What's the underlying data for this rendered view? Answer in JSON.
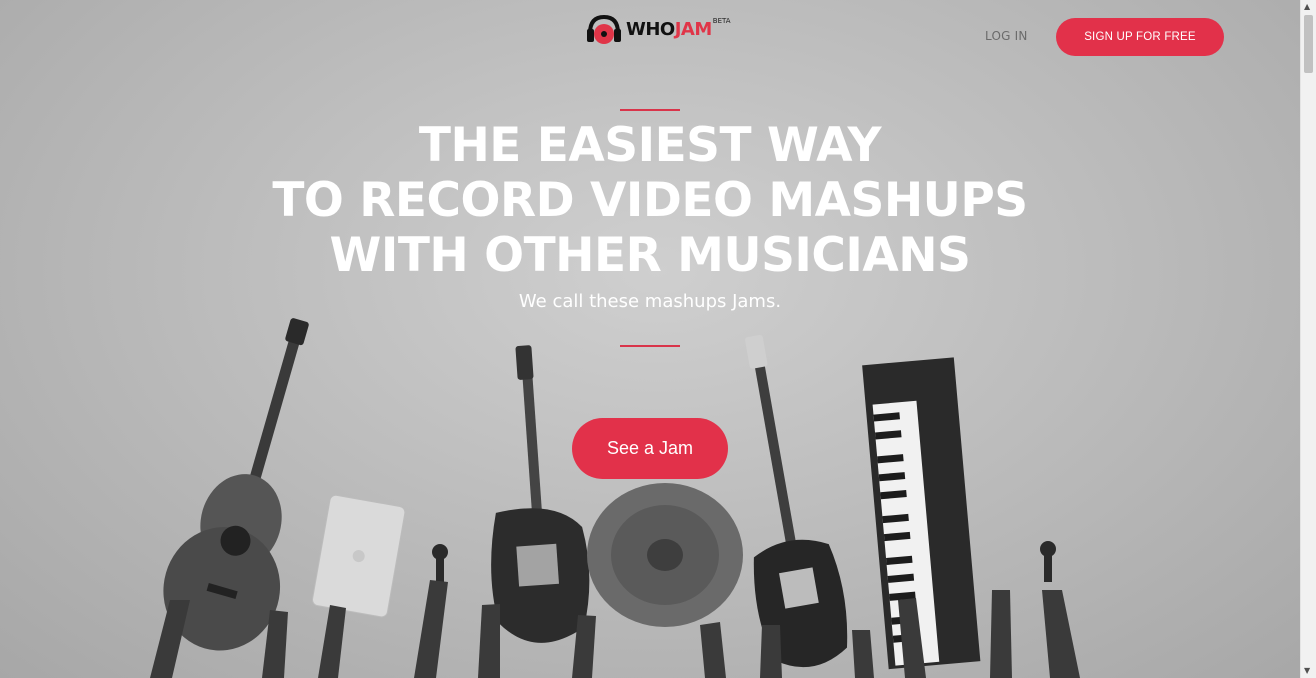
{
  "header": {
    "logo": {
      "who": "WHO",
      "jam": "JAM",
      "beta": "BETA"
    },
    "login_label": "LOG IN",
    "signup_label": "SIGN UP FOR FREE"
  },
  "hero": {
    "headline_lines": [
      "THE EASIEST WAY",
      "TO RECORD VIDEO MASHUPS",
      "WITH OTHER MUSICIANS"
    ],
    "subheadline": "We call these mashups Jams.",
    "cta_label": "See a Jam"
  },
  "colors": {
    "accent": "#e2314a",
    "headline": "#ffffff",
    "login_text": "#6b6b6b"
  },
  "icons": {
    "logo_mark": "headphones-record-icon",
    "scroll_up": "triangle-up-icon",
    "scroll_down": "triangle-down-icon"
  }
}
